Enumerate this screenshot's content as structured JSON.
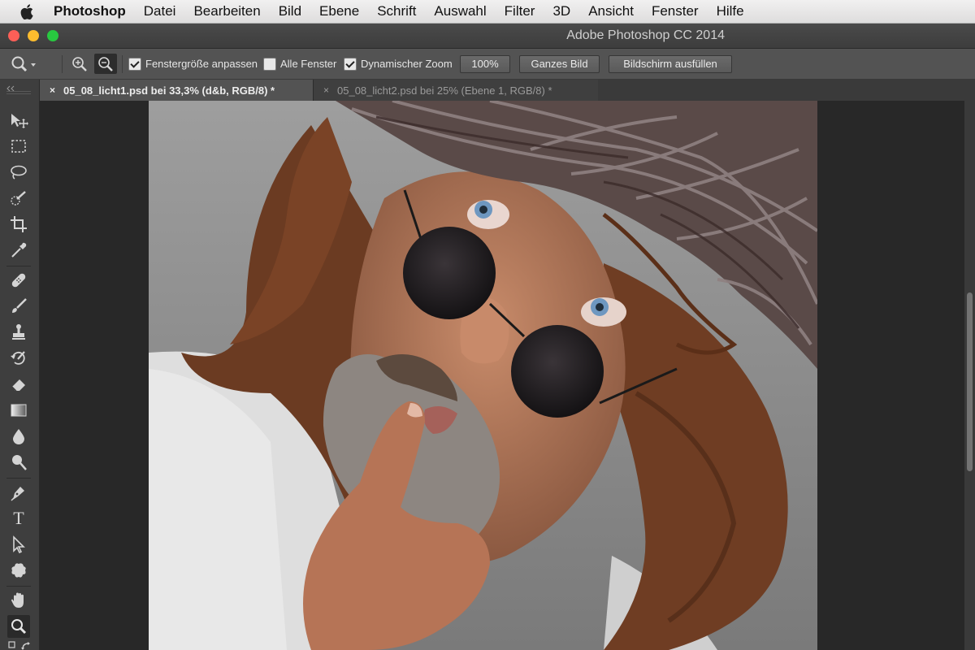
{
  "menubar": {
    "app_name": "Photoshop",
    "items": [
      "Datei",
      "Bearbeiten",
      "Bild",
      "Ebene",
      "Schrift",
      "Auswahl",
      "Filter",
      "3D",
      "Ansicht",
      "Fenster",
      "Hilfe"
    ]
  },
  "window": {
    "title": "Adobe Photoshop CC 2014",
    "traffic_colors": {
      "close": "#fc5f57",
      "minimize": "#fdbc2e",
      "zoom": "#28c840"
    }
  },
  "options_bar": {
    "fit_window": {
      "label": "Fenstergröße anpassen",
      "checked": true
    },
    "all_windows": {
      "label": "Alle Fenster",
      "checked": false
    },
    "scrubby_zoom": {
      "label": "Dynamischer Zoom",
      "checked": true
    },
    "btn_100": "100%",
    "btn_fit_screen": "Ganzes Bild",
    "btn_fill_screen": "Bildschirm ausfüllen"
  },
  "tabs": [
    {
      "label": "05_08_licht1.psd bei 33,3% (d&b, RGB/8) *",
      "active": true,
      "close": "×"
    },
    {
      "label": "05_08_licht2.psd bei 25% (Ebene 1, RGB/8) *",
      "active": false,
      "close": "×"
    }
  ],
  "tools": [
    {
      "icon": "move-icon"
    },
    {
      "icon": "marquee-icon"
    },
    {
      "icon": "lasso-icon"
    },
    {
      "icon": "quick-selection-icon"
    },
    {
      "icon": "crop-icon"
    },
    {
      "icon": "eyedropper-icon"
    },
    {
      "icon": "healing-brush-icon"
    },
    {
      "icon": "brush-icon"
    },
    {
      "icon": "clone-stamp-icon"
    },
    {
      "icon": "history-brush-icon"
    },
    {
      "icon": "eraser-icon"
    },
    {
      "icon": "gradient-icon"
    },
    {
      "icon": "blur-icon"
    },
    {
      "icon": "dodge-icon"
    },
    {
      "icon": "pen-icon"
    },
    {
      "icon": "type-icon",
      "glyph": "T"
    },
    {
      "icon": "path-selection-icon"
    },
    {
      "icon": "custom-shape-icon"
    },
    {
      "icon": "hand-icon"
    },
    {
      "icon": "zoom-icon",
      "active": true
    }
  ],
  "colors": {
    "ui_dark": "#3e3e3e",
    "ui_mid": "#535353",
    "canvas_bg": "#282828",
    "menubar_bg": "#e8e7e7"
  },
  "canvas": {
    "content": "photo-portrait"
  }
}
